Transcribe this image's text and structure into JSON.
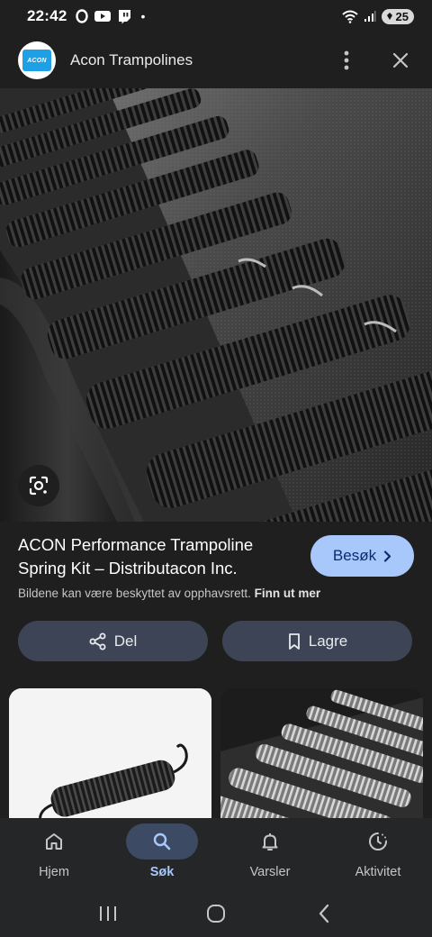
{
  "status_bar": {
    "time": "22:42",
    "dot": "•",
    "battery": "25"
  },
  "header": {
    "logo_text": "ACON",
    "title": "Acon Trampolines"
  },
  "result": {
    "title": "ACON Performance Trampoline Spring Kit – Distributacon Inc.",
    "visit_label": "Besøk",
    "copyright_text": "Bildene kan være beskyttet av opphavsrett.",
    "learn_more": "Finn ut mer"
  },
  "actions": {
    "share_label": "Del",
    "save_label": "Lagre"
  },
  "bottom_nav": {
    "items": [
      {
        "label": "Hjem",
        "icon": "home-icon"
      },
      {
        "label": "Søk",
        "icon": "search-icon",
        "active": true
      },
      {
        "label": "Varsler",
        "icon": "bell-icon"
      },
      {
        "label": "Aktivitet",
        "icon": "activity-icon"
      }
    ]
  },
  "colors": {
    "accent": "#a8c7fa",
    "background": "#1f1f1f",
    "button": "#3c4455"
  }
}
